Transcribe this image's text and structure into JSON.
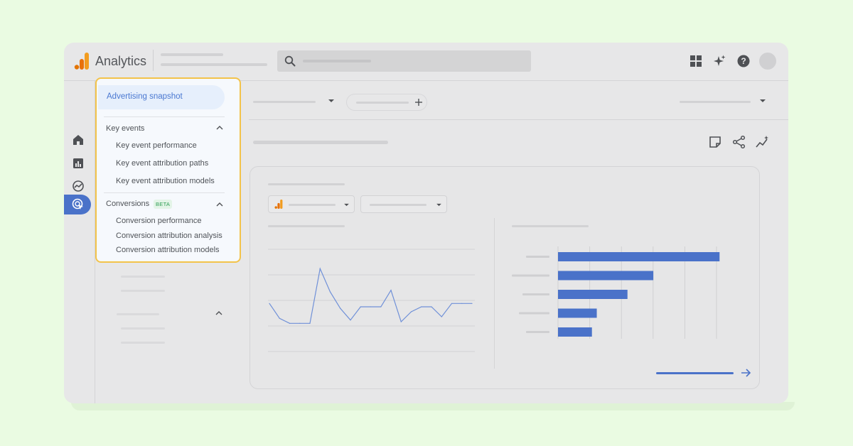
{
  "header": {
    "app_title": "Analytics",
    "icons": [
      "apps-grid-icon",
      "sparkle-icon",
      "help-icon"
    ]
  },
  "search": {
    "icon": "search-icon"
  },
  "rail": {
    "icons": [
      "home-icon",
      "reports-icon",
      "explore-icon",
      "advertising-icon"
    ],
    "active": "advertising-icon"
  },
  "menu": {
    "snapshot_label": "Advertising snapshot",
    "key_events": {
      "title": "Key events",
      "items": [
        "Key event performance",
        "Key event attribution paths",
        "Key event attribution models"
      ]
    },
    "conversions": {
      "title": "Conversions",
      "badge": "BETA",
      "items": [
        "Conversion performance",
        "Conversion attribution analysis",
        "Conversion attribution models"
      ]
    }
  },
  "toolbar": {
    "icons": [
      "notes-icon",
      "share-icon",
      "insights-icon"
    ]
  },
  "colors": {
    "accent": "#4a72c9",
    "menu_highlight": "#f3c34a",
    "bar": "#4a72c9",
    "line": "#6f90d8"
  },
  "chart_data": [
    {
      "type": "line",
      "x": [
        0,
        1,
        2,
        3,
        4,
        5,
        6,
        7,
        8,
        9,
        10,
        11,
        12,
        13,
        14,
        15,
        16,
        17,
        18,
        19,
        20
      ],
      "values": [
        58,
        40,
        34,
        34,
        34,
        100,
        72,
        52,
        38,
        54,
        54,
        54,
        74,
        36,
        48,
        54,
        54,
        42,
        58,
        58,
        58
      ],
      "ylim": [
        0,
        120
      ]
    },
    {
      "type": "bar",
      "orientation": "horizontal",
      "categories": [
        "",
        "",
        "",
        "",
        ""
      ],
      "values": [
        100,
        59,
        43,
        24,
        21
      ],
      "xlim": [
        0,
        110
      ]
    }
  ]
}
